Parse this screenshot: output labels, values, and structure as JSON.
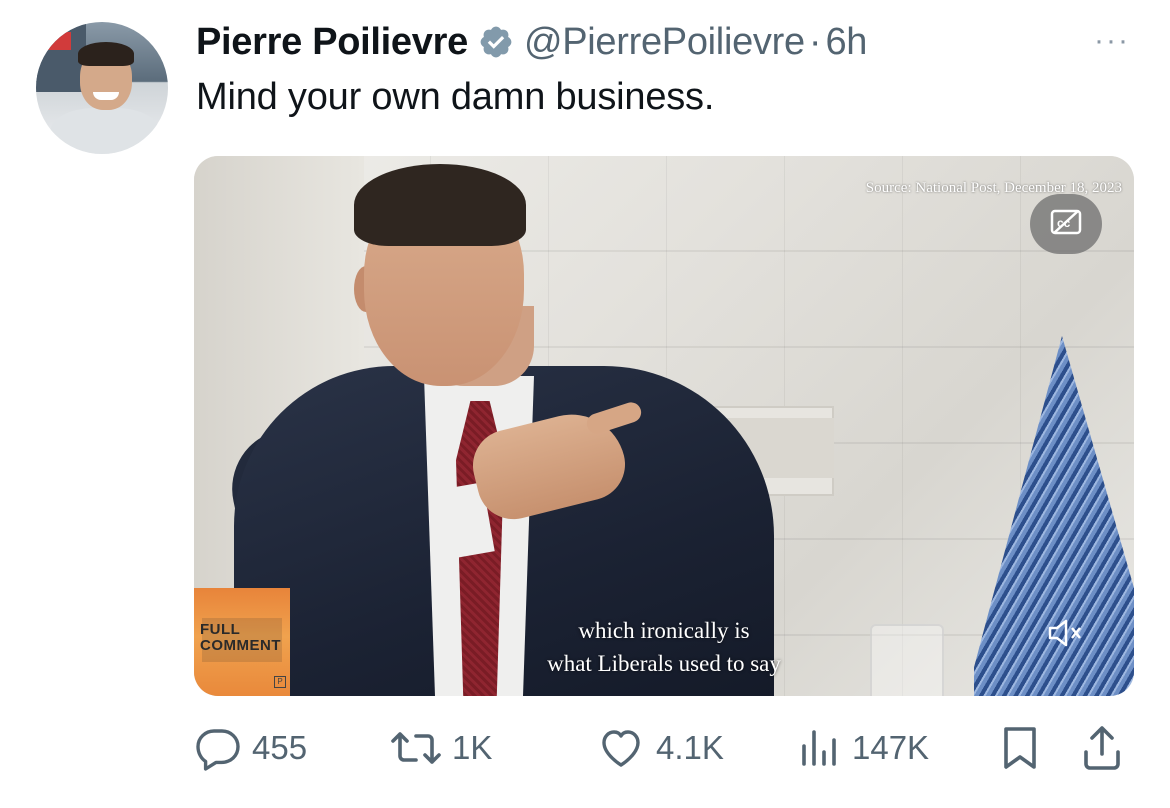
{
  "author": {
    "name": "Pierre Poilievre",
    "handle": "@PierrePoilievre",
    "separator": "·",
    "time": "6h"
  },
  "more_label": "···",
  "tweet_text": "Mind your own damn business.",
  "media": {
    "source_caption": "Source: National Post, December 18, 2023",
    "subtitle_line1": "which ironically is",
    "subtitle_line2": "what Liberals used to say",
    "badge_text": "FULL\nCOMMENT",
    "badge_logo": "P"
  },
  "actions": {
    "replies": "455",
    "reposts": "1K",
    "likes": "4.1K",
    "views": "147K"
  },
  "colors": {
    "verified": "#829aab",
    "secondary_text": "#536471"
  },
  "icons": [
    "verified-badge-icon",
    "more-icon",
    "captions-off-icon",
    "mute-icon",
    "reply-icon",
    "repost-icon",
    "like-icon",
    "views-icon",
    "bookmark-icon",
    "share-icon"
  ]
}
